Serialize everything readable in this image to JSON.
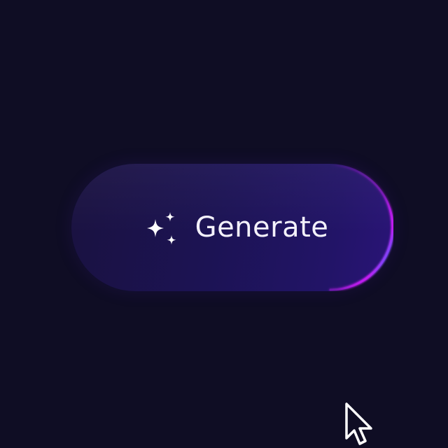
{
  "button": {
    "label": "Generate",
    "icon": "sparkles-icon"
  },
  "colors": {
    "background": "#0f0d24",
    "button_fill": "#1c1354",
    "glow_magenta": "#c21cf0",
    "glow_blue": "#3a6bff",
    "glow_cyan": "#1fc8ff",
    "text": "#f3f1fb"
  },
  "cursor": {
    "icon": "arrow-cursor-icon"
  }
}
